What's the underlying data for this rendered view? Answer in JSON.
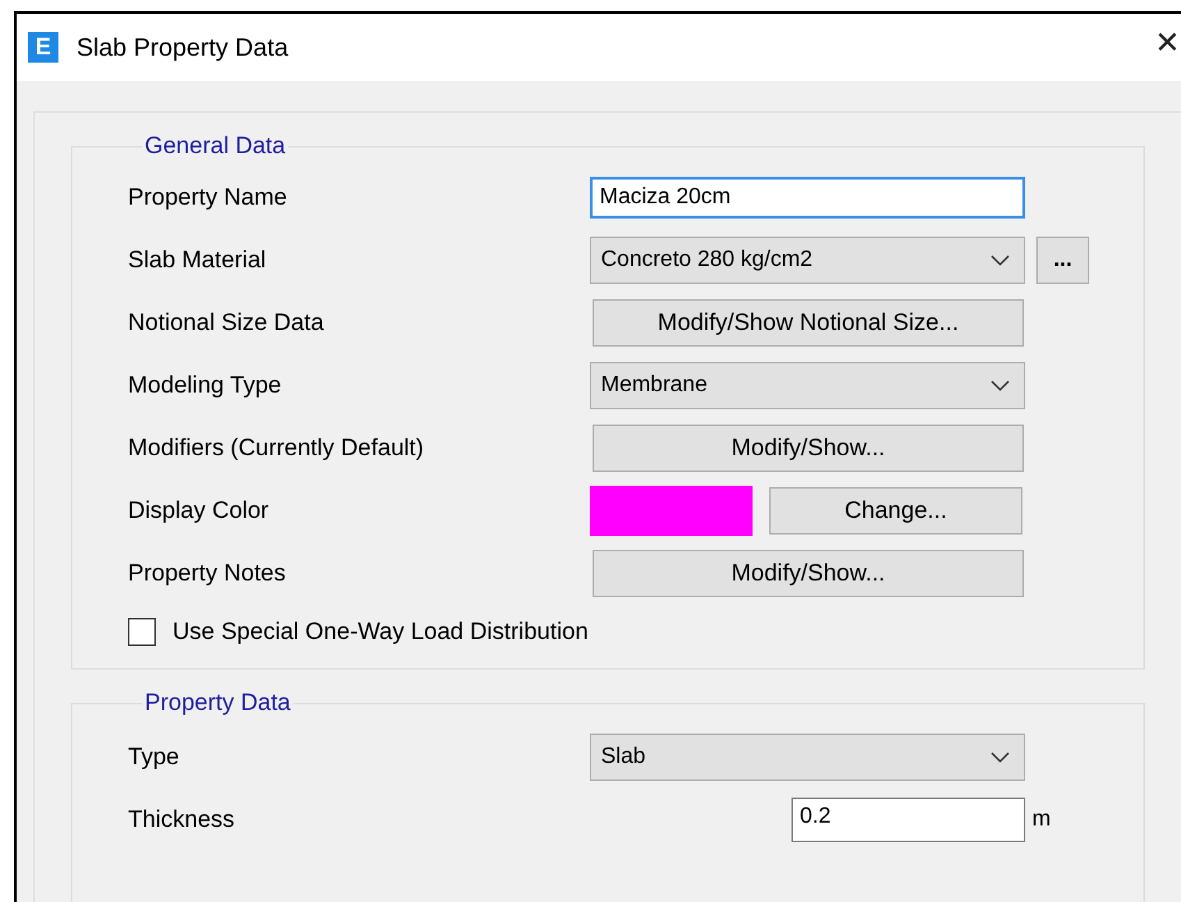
{
  "window": {
    "title": "Slab Property Data",
    "icon_text": "E",
    "close": "✕"
  },
  "general_data": {
    "title": "General Data",
    "rows": [
      {
        "label": "Property Name",
        "kind": "input",
        "value": "Maciza 20cm",
        "focused": true
      },
      {
        "label": "Slab Material",
        "kind": "select",
        "value": "Concreto 280 kg/cm2",
        "extra_button": "..."
      },
      {
        "label": "Notional Size Data",
        "kind": "button",
        "value": "Modify/Show Notional Size..."
      },
      {
        "label": "Modeling Type",
        "kind": "select",
        "value": "Membrane"
      },
      {
        "label": "Modifiers (Currently Default)",
        "kind": "button",
        "value": "Modify/Show..."
      },
      {
        "label": "Display Color",
        "kind": "color",
        "color": "#ff00ff",
        "value": "Change..."
      },
      {
        "label": "Property Notes",
        "kind": "button",
        "value": "Modify/Show..."
      }
    ],
    "checkbox": {
      "label": "Use Special One-Way Load Distribution",
      "checked": false
    }
  },
  "property_data": {
    "title": "Property Data",
    "rows": [
      {
        "label": "Type",
        "kind": "select",
        "value": "Slab"
      },
      {
        "label": "Thickness",
        "kind": "input_unit",
        "value": "0.2",
        "unit": "m",
        "focused": false
      }
    ]
  }
}
